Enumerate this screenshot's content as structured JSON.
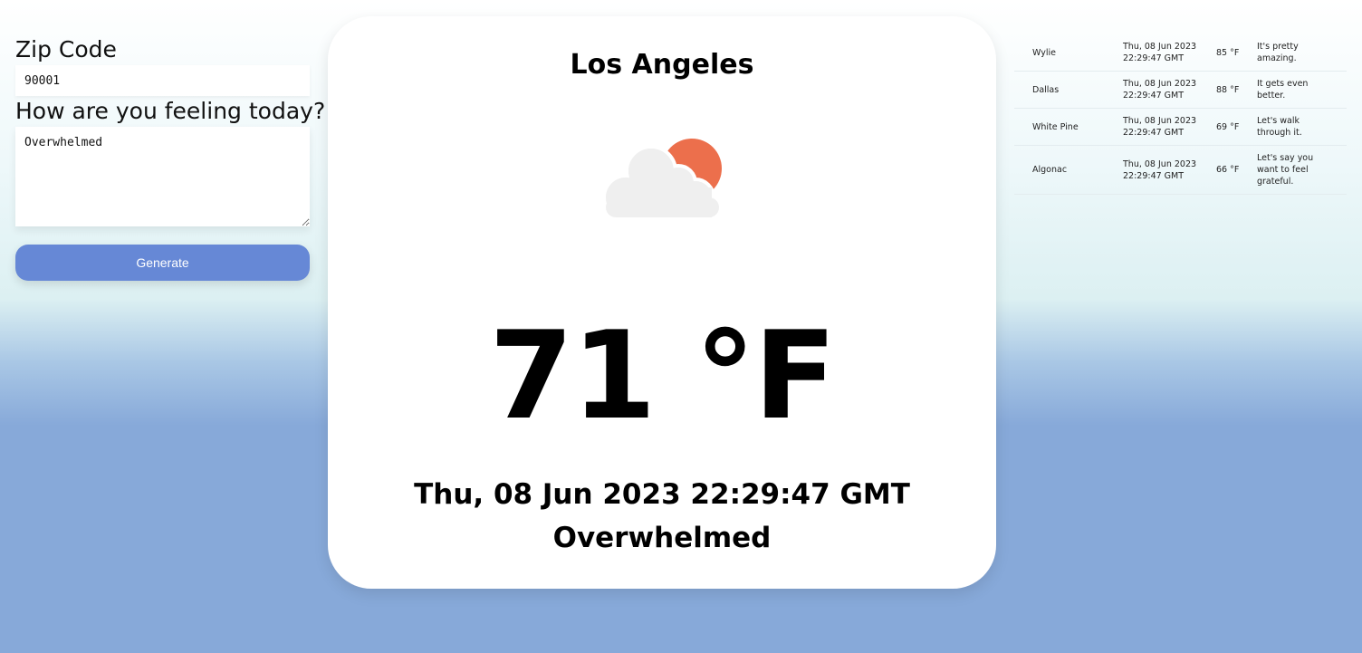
{
  "form": {
    "zip_label": "Zip Code",
    "zip_value": "90001",
    "feeling_label": "How are you feeling today?",
    "feeling_value": "Overwhelmed",
    "generate_label": "Generate"
  },
  "card": {
    "city": "Los Angeles",
    "icon": "partly-cloudy-icon",
    "temperature": "71 °F",
    "date": "Thu, 08 Jun 2023 22:29:47 GMT",
    "feeling": "Overwhelmed"
  },
  "history": [
    {
      "city": "Wylie",
      "date": "Thu, 08 Jun 2023 22:29:47 GMT",
      "temp": "85 °F",
      "feeling": "It's pretty amazing."
    },
    {
      "city": "Dallas",
      "date": "Thu, 08 Jun 2023 22:29:47 GMT",
      "temp": "88 °F",
      "feeling": "It gets even better."
    },
    {
      "city": "White Pine",
      "date": "Thu, 08 Jun 2023 22:29:47 GMT",
      "temp": "69 °F",
      "feeling": "Let's walk through it."
    },
    {
      "city": "Algonac",
      "date": "Thu, 08 Jun 2023 22:29:47 GMT",
      "temp": "66 °F",
      "feeling": "Let's say you want to feel grateful."
    }
  ],
  "colors": {
    "accent": "#6688d6",
    "sun": "#ec6f4c",
    "cloud": "#efefef",
    "background_bottom": "#87a9d9"
  }
}
